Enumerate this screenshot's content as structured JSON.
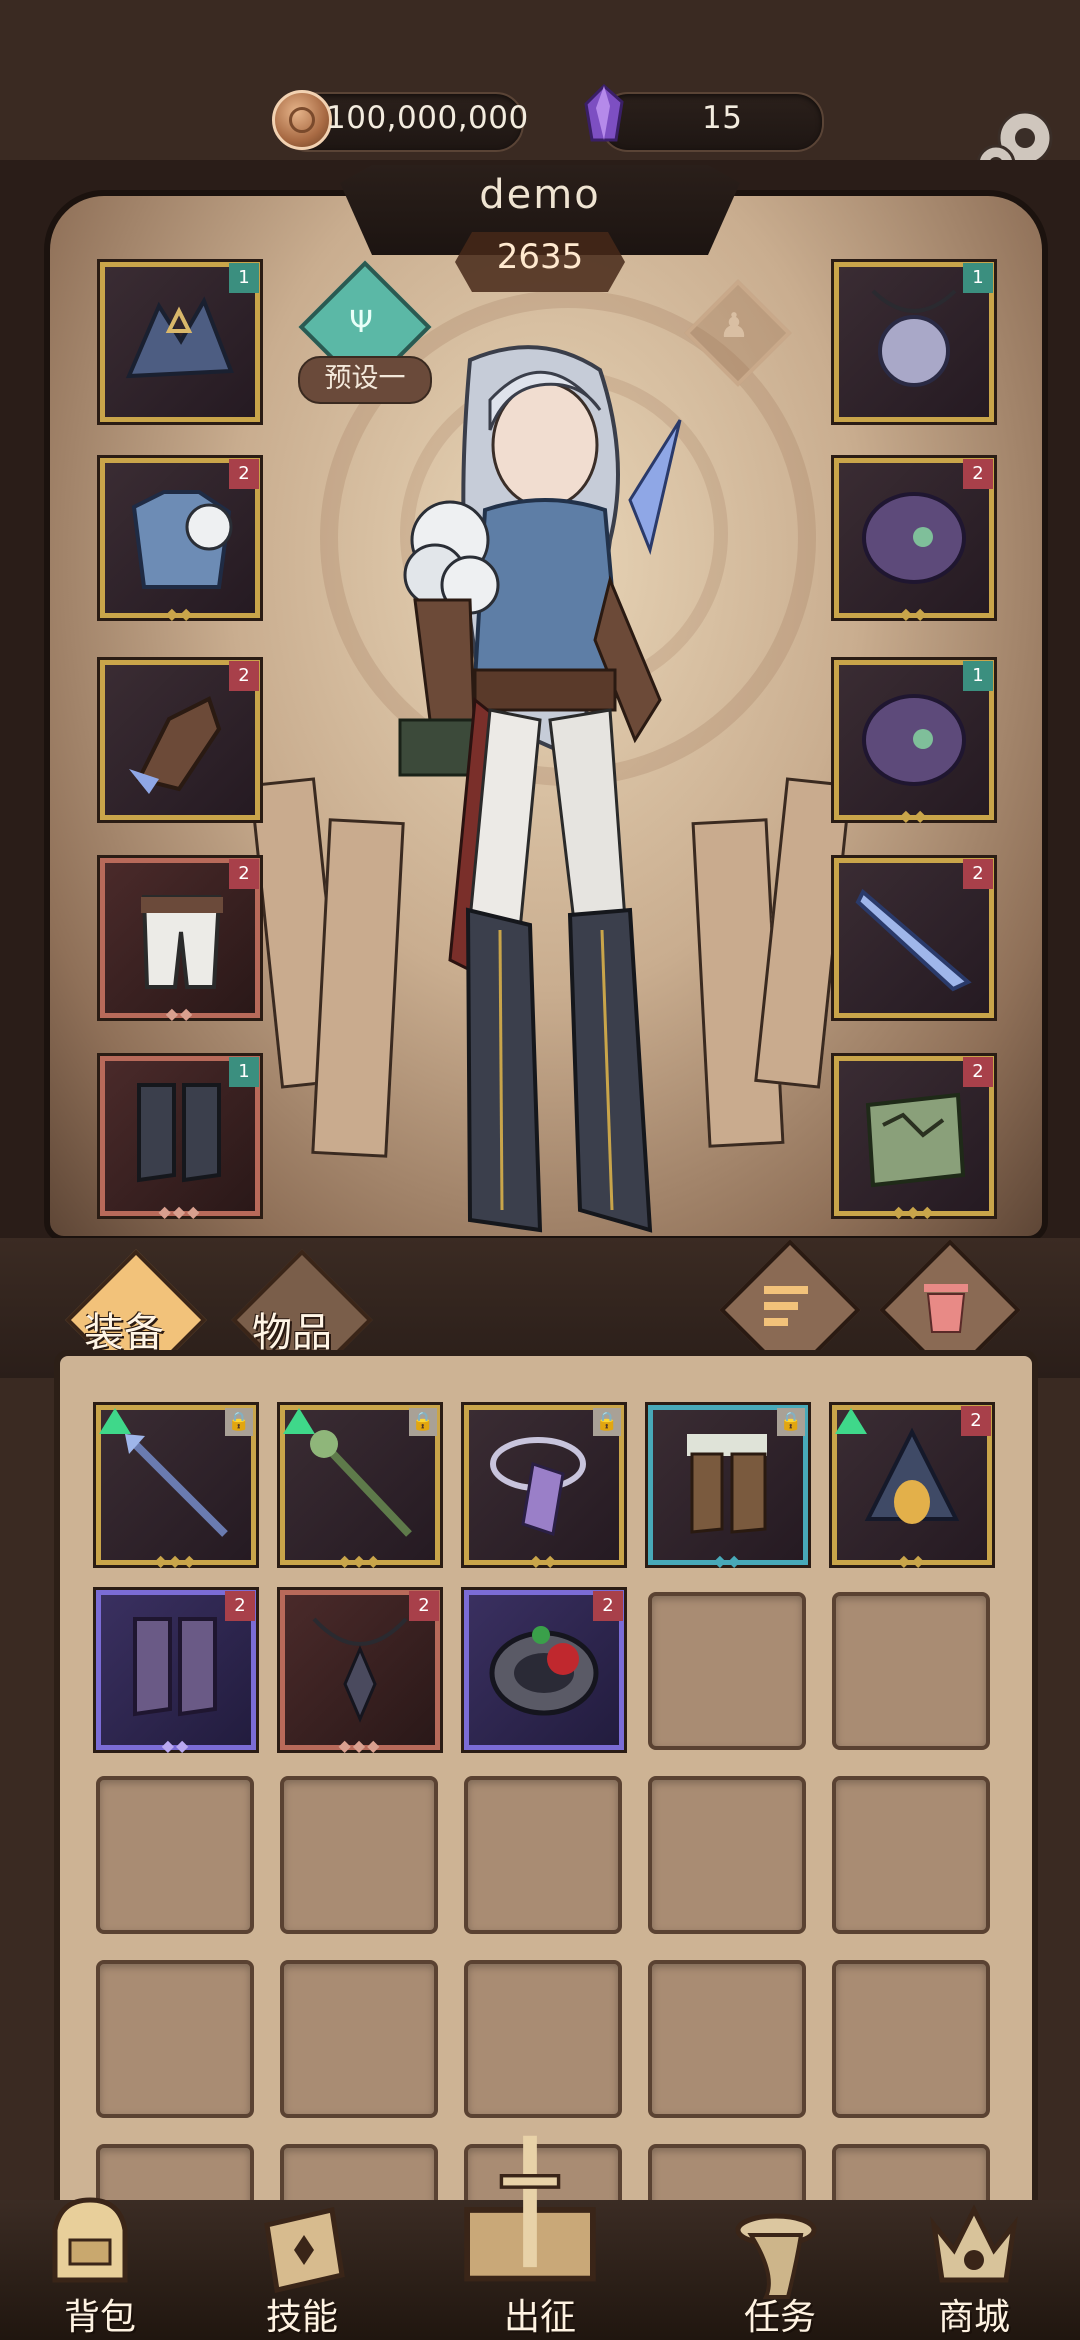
{
  "currency": {
    "gold": "100,000,000",
    "gems": "15"
  },
  "player": {
    "name": "demo",
    "power": "2635"
  },
  "preset": {
    "label": "预设一"
  },
  "tabs": [
    {
      "label": "装备"
    },
    {
      "label": "物品"
    }
  ],
  "nav": [
    {
      "label": "背包"
    },
    {
      "label": "技能"
    },
    {
      "label": "出征"
    },
    {
      "label": "任务"
    },
    {
      "label": "商城"
    }
  ],
  "equipped_left": [
    {
      "name": "crown",
      "badge": "1",
      "quality": "gold"
    },
    {
      "name": "armor",
      "badge": "2",
      "quality": "gold"
    },
    {
      "name": "gloves",
      "badge": "2",
      "quality": "gold"
    },
    {
      "name": "pants",
      "badge": "2",
      "quality": "red"
    },
    {
      "name": "boots",
      "badge": "1",
      "quality": "red"
    }
  ],
  "equipped_right": [
    {
      "name": "amulet",
      "badge": "1",
      "quality": "gold"
    },
    {
      "name": "bracer",
      "badge": "2",
      "quality": "gold"
    },
    {
      "name": "bracer",
      "badge": "1",
      "quality": "gold"
    },
    {
      "name": "dagger",
      "badge": "2",
      "quality": "gold"
    },
    {
      "name": "relic",
      "badge": "2",
      "quality": "gold"
    }
  ],
  "inventory": [
    {
      "name": "staff",
      "quality": "gold",
      "upgrade": true,
      "locked": true
    },
    {
      "name": "staff",
      "quality": "gold",
      "upgrade": true,
      "locked": true
    },
    {
      "name": "crystal-orb",
      "quality": "gold",
      "upgrade": false,
      "locked": true
    },
    {
      "name": "boots",
      "quality": "blue",
      "upgrade": false,
      "locked": true
    },
    {
      "name": "helmet",
      "quality": "gold",
      "upgrade": true,
      "badge": "2"
    },
    {
      "name": "boots",
      "quality": "purple",
      "badge": "2"
    },
    {
      "name": "necklace",
      "quality": "red",
      "badge": "2"
    },
    {
      "name": "ring",
      "quality": "purple",
      "badge": "2"
    }
  ],
  "colors": {
    "gold": "#c9a54a",
    "red": "#b86a5a",
    "blue": "#48a9b8",
    "purple": "#7b6cd6",
    "badge_teal": "#3b8f7f",
    "badge_red": "#a8404a"
  }
}
